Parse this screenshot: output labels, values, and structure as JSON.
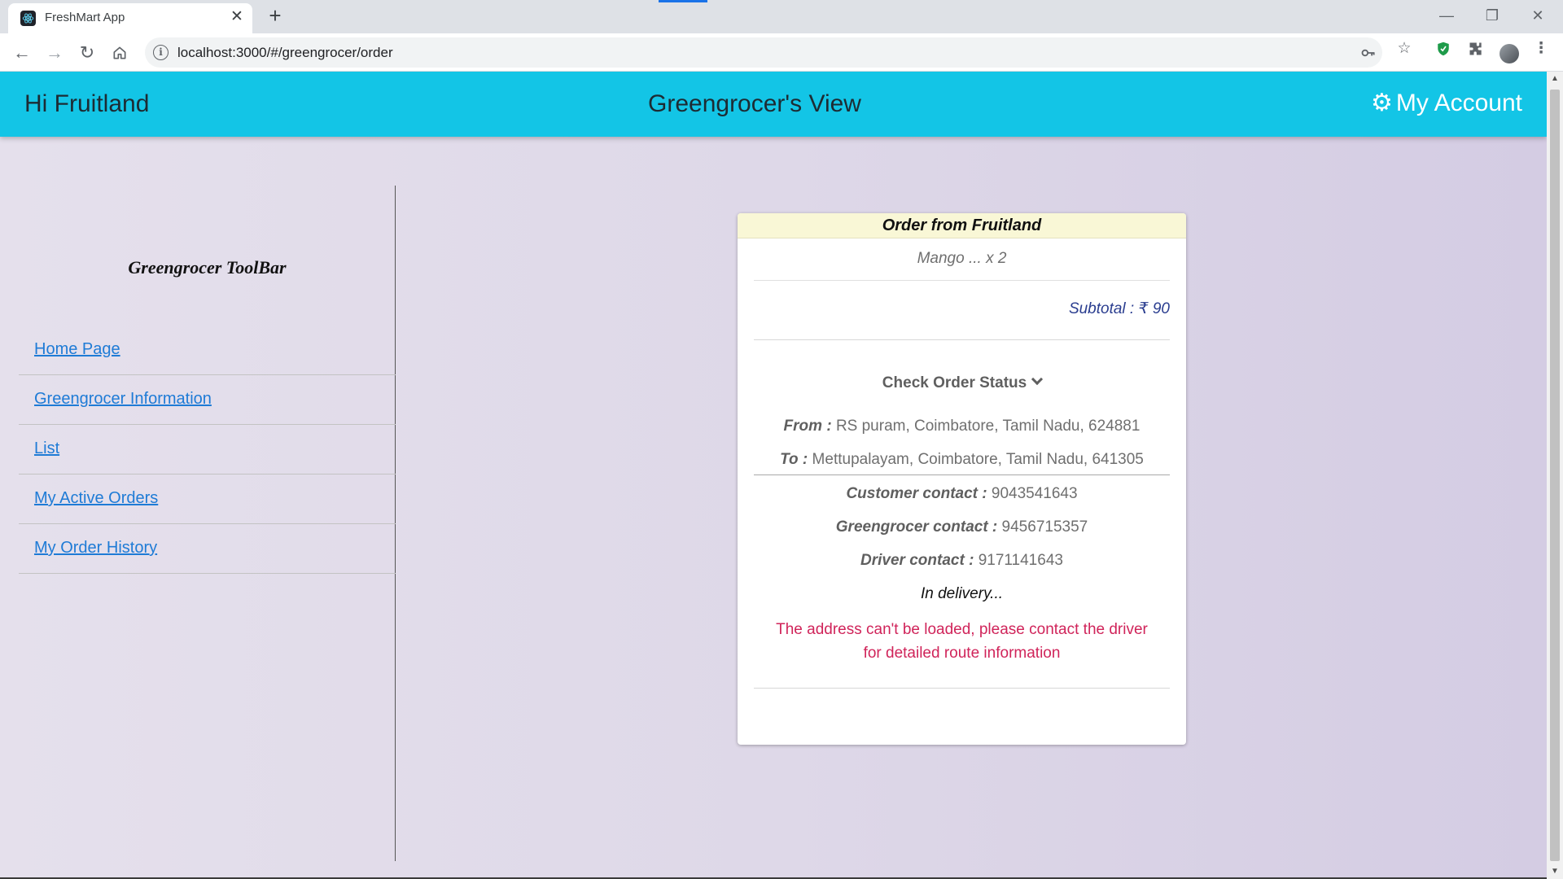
{
  "browser": {
    "tab_title": "FreshMart App",
    "tab_close": "✕",
    "new_tab": "+",
    "url": "localhost:3000/#/greengrocer/order",
    "window_controls": {
      "minimize": "—",
      "restore": "❐",
      "close": "✕"
    },
    "icons": [
      "react-favicon-icon",
      "back-arrow-icon",
      "forward-arrow-icon",
      "reload-icon",
      "home-icon",
      "site-info-icon",
      "key-icon",
      "star-icon",
      "shield-extension-icon",
      "puzzle-extension-icon",
      "profile-avatar",
      "kebab-menu-icon"
    ]
  },
  "appbar": {
    "greeting": "Hi Fruitland",
    "view_title": "Greengrocer's View",
    "account_label": "My Account",
    "color": "#13c5e6"
  },
  "sidebar": {
    "title": "Greengrocer ToolBar",
    "items": [
      {
        "label": "Home Page"
      },
      {
        "label": "Greengrocer Information"
      },
      {
        "label": "List"
      },
      {
        "label": "My Active Orders"
      },
      {
        "label": "My Order History"
      }
    ]
  },
  "order": {
    "header": "Order from Fruitland",
    "item_line": "Mango ... x 2",
    "subtotal": "Subtotal : ₹ 90",
    "status_toggle": "Check Order Status",
    "from_label": "From :",
    "from_value": "RS puram, Coimbatore, Tamil Nadu, 624881",
    "to_label": "To :",
    "to_value": "Mettupalayam, Coimbatore, Tamil Nadu, 641305",
    "customer_label": "Customer contact :",
    "customer_value": "9043541643",
    "greengrocer_label": "Greengrocer contact :",
    "greengrocer_value": "9456715357",
    "driver_label": "Driver contact :",
    "driver_value": "9171141643",
    "delivery_status": "In delivery...",
    "warning_line1": "The address can't be loaded, please contact the driver",
    "warning_line2": "for detailed route information",
    "header_color": "#f9f7d6",
    "warning_color": "#d0245a"
  }
}
